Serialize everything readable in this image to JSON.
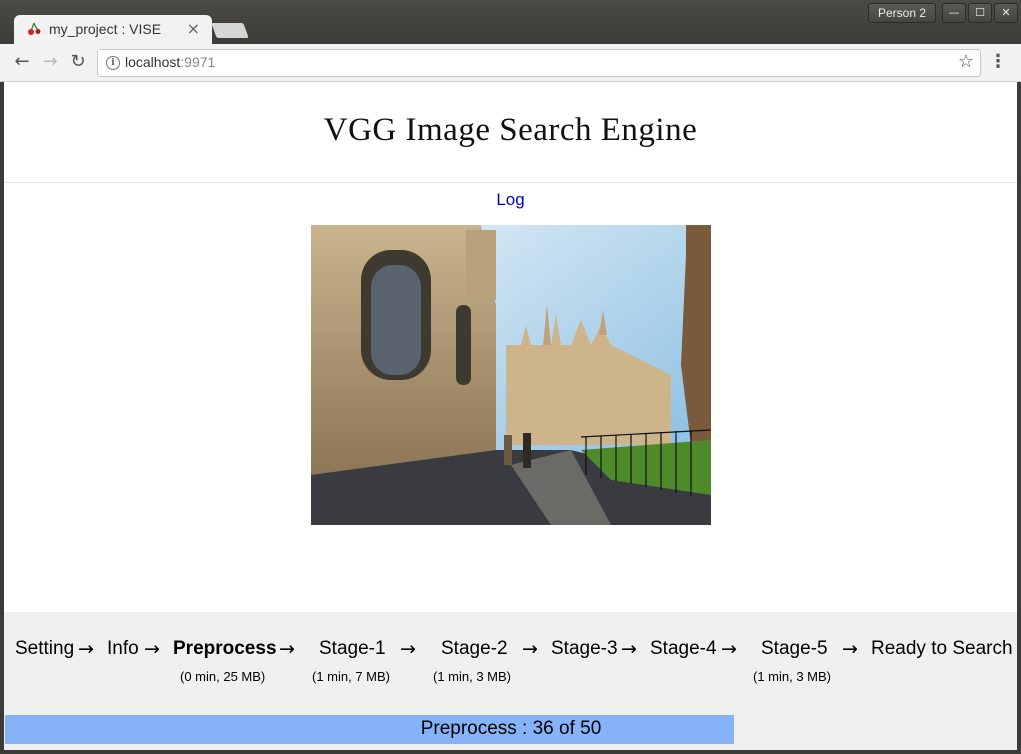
{
  "browser": {
    "tab_title": "my_project : VISE",
    "profile_label": "Person 2",
    "url_host": "localhost",
    "url_port": ":9971"
  },
  "page": {
    "title": "VGG Image Search Engine",
    "log_link": "Log"
  },
  "pipeline": {
    "stages": [
      {
        "label": "Setting"
      },
      {
        "label": "Info"
      },
      {
        "label": "Preprocess",
        "active": true,
        "stat": "(0 min, 25 MB)"
      },
      {
        "label": "Stage-1",
        "stat": "(1 min, 7 MB)"
      },
      {
        "label": "Stage-2",
        "stat": "(1 min, 3 MB)"
      },
      {
        "label": "Stage-3"
      },
      {
        "label": "Stage-4"
      },
      {
        "label": "Stage-5",
        "stat": "(1 min, 3 MB)"
      },
      {
        "label": "Ready to Search"
      }
    ],
    "arrow": "→",
    "progress": {
      "text": "Preprocess : 36 of 50",
      "done": 36,
      "total": 50,
      "fill_color": "#86b3f8"
    }
  },
  "icons": {
    "back": "arrow-left-icon",
    "forward": "arrow-right-icon",
    "reload": "reload-icon",
    "info": "info-icon",
    "star": "star-icon",
    "menu": "kebab-menu-icon"
  }
}
